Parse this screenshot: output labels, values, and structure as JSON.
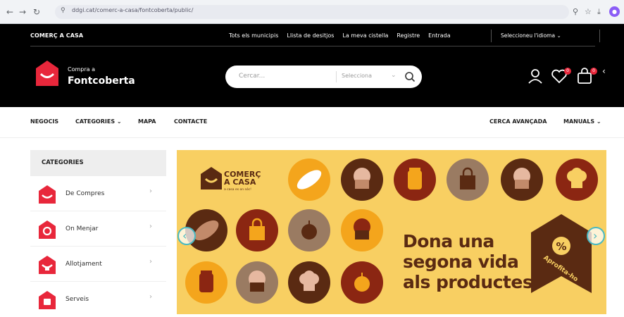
{
  "browser": {
    "url": "ddgi.cat/comerc-a-casa/fontcoberta/public/"
  },
  "top": {
    "brand": "COMERÇ A CASA",
    "links": [
      "Tots els municipis",
      "Llista de desitjos",
      "La meva cistella",
      "Registre",
      "Entrada"
    ],
    "language": "Seleccioneu l'idioma ⌄"
  },
  "header": {
    "logo_small": "Compra a",
    "logo_big": "Fontcoberta",
    "search_placeholder": "Cercar...",
    "search_select": "Selecciona",
    "wishlist_count": "0",
    "cart_count": "0"
  },
  "nav": {
    "items": [
      "NEGOCIS",
      "CATEGORIES ⌄",
      "MAPA",
      "CONTACTE"
    ],
    "right": [
      "CERCA AVANÇADA",
      "MANUALS ⌄"
    ]
  },
  "sidebar": {
    "title": "CATEGORIES",
    "items": [
      "De Compres",
      "On Menjar",
      "Allotjament",
      "Serveis"
    ]
  },
  "banner": {
    "logo_line1": "COMERÇ",
    "logo_line2": "A CASA",
    "logo_tag": "a casa es on sóc!",
    "headline": [
      "Dona una",
      "segona vida",
      "als productes"
    ],
    "stamp_text": "Aprofita-ho"
  },
  "colors": {
    "red": "#e8273b",
    "banner_bg": "#f8cf62",
    "brown_dark": "#5a2a12",
    "brown_red": "#8b2612",
    "accent_teal": "#49b9c2"
  }
}
